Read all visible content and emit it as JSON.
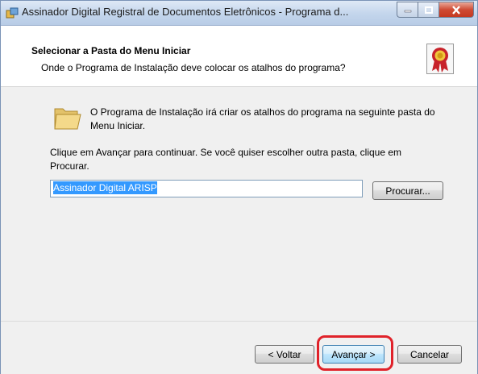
{
  "window": {
    "title": "Assinador Digital Registral de Documentos Eletrônicos - Programa d...",
    "accent": "#c43820"
  },
  "header": {
    "title": "Selecionar a Pasta do Menu Iniciar",
    "subtitle": "Onde o Programa de Instalação deve colocar os atalhos do programa?"
  },
  "body": {
    "folder_text": "O Programa de Instalação irá criar os atalhos do programa na seguinte pasta do Menu Iniciar.",
    "continue_text": "Clique em Avançar para continuar. Se você quiser escolher outra pasta, clique em Procurar.",
    "folder_value": "Assinador Digital ARISP",
    "browse_label": "Procurar..."
  },
  "footer": {
    "back_label": "< Voltar",
    "next_label": "Avançar >",
    "cancel_label": "Cancelar"
  },
  "icons": {
    "app": "installer-icon",
    "award": "award-ribbon-icon",
    "folder": "folder-icon"
  }
}
